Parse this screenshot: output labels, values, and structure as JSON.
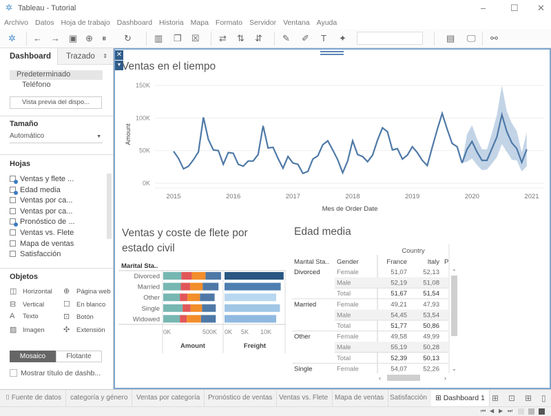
{
  "window": {
    "title": "Tableau - Tutorial",
    "minimize": "–",
    "maximize": "☐",
    "close": "✕"
  },
  "menu": [
    "Archivo",
    "Datos",
    "Hoja de trabajo",
    "Dashboard",
    "Historia",
    "Mapa",
    "Formato",
    "Servidor",
    "Ventana",
    "Ayuda"
  ],
  "toolbar": {
    "icons": [
      "tableau-logo",
      "back",
      "forward",
      "save",
      "new-datasource",
      "pause-updates",
      "refresh",
      "new-worksheet",
      "duplicate",
      "clear",
      "swap",
      "sort-asc",
      "sort-desc",
      "highlight",
      "annotate",
      "label",
      "pin",
      "show-me",
      "presentation",
      "share"
    ]
  },
  "left_panel": {
    "tabs": [
      "Dashboard",
      "Trazado"
    ],
    "devices": [
      "Predeterminado",
      "Teléfono"
    ],
    "preview_button": "Vista previa del dispo...",
    "size_title": "Tamaño",
    "size_value": "Automático",
    "sheets_title": "Hojas",
    "sheets": [
      {
        "label": "Ventas y flete ...",
        "used": true
      },
      {
        "label": "Edad media",
        "used": true
      },
      {
        "label": "Ventas por ca...",
        "used": false
      },
      {
        "label": "Ventas por ca...",
        "used": false
      },
      {
        "label": "Pronóstico de ...",
        "used": true
      },
      {
        "label": "Ventas vs. Flete",
        "used": false
      },
      {
        "label": "Mapa de ventas",
        "used": false
      },
      {
        "label": "Satisfacción",
        "used": false
      }
    ],
    "objects_title": "Objetos",
    "objects": [
      {
        "label": "Horizontal",
        "icon": "◫"
      },
      {
        "label": "Página web",
        "icon": "⊕"
      },
      {
        "label": "Vertical",
        "icon": "⊟"
      },
      {
        "label": "En blanco",
        "icon": "☐"
      },
      {
        "label": "Texto",
        "icon": "A"
      },
      {
        "label": "Botón",
        "icon": "⊡"
      },
      {
        "label": "Imagen",
        "icon": "▨"
      },
      {
        "label": "Extensión",
        "icon": "✣"
      }
    ],
    "layout_toggle": [
      "Mosaico",
      "Flotante"
    ],
    "show_title": "Mostrar título de dashb...",
    "show_title_checked": false
  },
  "chart_data": [
    {
      "type": "line",
      "title": "Ventas en el tiempo",
      "xlabel": "Mes de Order Date",
      "ylabel": "Amount",
      "x_ticks": [
        "2015",
        "2016",
        "2017",
        "2018",
        "2019",
        "2020",
        "2021"
      ],
      "y_ticks": [
        "0K",
        "50K",
        "100K",
        "150K"
      ],
      "ylim": [
        0,
        150000
      ],
      "grid": true,
      "start": "2015-01",
      "actual": [
        49000,
        38000,
        22000,
        26000,
        36000,
        48000,
        101000,
        67000,
        51000,
        50000,
        29000,
        47000,
        46000,
        29000,
        26000,
        34000,
        34000,
        44000,
        88000,
        54000,
        55000,
        38000,
        23000,
        41000,
        31000,
        29000,
        15000,
        18000,
        37000,
        42000,
        59000,
        65000,
        51000,
        36000,
        16000,
        34000,
        65000,
        44000,
        41000,
        33000,
        43000,
        66000,
        85000,
        79000,
        51000,
        53000,
        37000,
        43000,
        56000,
        47000,
        35000,
        27000,
        55000,
        82000,
        107000,
        83000,
        61000,
        56000,
        31000
      ],
      "forecast_start": "2019-11",
      "forecast": [
        31000,
        52000,
        64000,
        48000,
        35000,
        35000,
        53000,
        71000,
        105000,
        79000,
        62000,
        53000,
        32000,
        52000
      ],
      "forecast_low": [
        31000,
        33000,
        38000,
        28000,
        20000,
        21000,
        30000,
        40000,
        60000,
        48000,
        36000,
        35000,
        18000,
        26000
      ],
      "forecast_high": [
        31000,
        75000,
        89000,
        68000,
        52000,
        52000,
        77000,
        105000,
        150000,
        110000,
        92000,
        80000,
        47000,
        78000
      ],
      "colors": {
        "line": "#4e79a7",
        "band": "#b8cce3"
      }
    },
    {
      "type": "bar",
      "title": "Ventas y coste de flete por estado civil",
      "row_header": "Marital Sta..",
      "categories": [
        "Divorced",
        "Married",
        "Other",
        "Single",
        "Widowed"
      ],
      "panes": [
        {
          "name": "Amount",
          "x_ticks": [
            "0K",
            "500K"
          ],
          "xlim": [
            0,
            700000
          ],
          "stacked": true,
          "segment_colors": [
            "#76b7b2",
            "#e15759",
            "#f28e2b",
            "#4e79a7"
          ],
          "values": [
            [
              200000,
              114000,
              151000,
              171000
            ],
            [
              193000,
              103000,
              138000,
              174000
            ],
            [
              183000,
              83000,
              138000,
              161000
            ],
            [
              213000,
              88000,
              126000,
              151000
            ],
            [
              183000,
              76000,
              156000,
              163000
            ]
          ]
        },
        {
          "name": "Freight",
          "x_ticks": [
            "0K",
            "5K",
            "10K"
          ],
          "xlim": [
            0,
            14500
          ],
          "values": [
            14300,
            13600,
            12500,
            13400,
            12500
          ],
          "colors": [
            "#2a5783",
            "#4e7fb0",
            "#b9d7f0",
            "#a0c6e6",
            "#8fb9e0"
          ]
        }
      ]
    },
    {
      "type": "table",
      "title": "Edad media",
      "column_group": "Country",
      "headers": [
        "Marital Sta..",
        "Gender",
        "France",
        "Italy",
        "P"
      ],
      "rows": [
        [
          "Divorced",
          "Female",
          "51,07",
          "52,13"
        ],
        [
          "",
          "Male",
          "52,19",
          "51,08"
        ],
        [
          "",
          "Total",
          "51,67",
          "51,54"
        ],
        [
          "Married",
          "Female",
          "49,21",
          "47,93"
        ],
        [
          "",
          "Male",
          "54,45",
          "53,54"
        ],
        [
          "",
          "Total",
          "51,77",
          "50,86"
        ],
        [
          "Other",
          "Female",
          "49,58",
          "49,99"
        ],
        [
          "",
          "Male",
          "55,19",
          "50,28"
        ],
        [
          "",
          "Total",
          "52,39",
          "50,13"
        ],
        [
          "Single",
          "Female",
          "54,07",
          "52,26"
        ]
      ]
    }
  ],
  "tabs": {
    "datasource": "Fuente de datos",
    "sheets": [
      "categoría y género",
      "Ventas por categoría",
      "Pronóstico de ventas",
      "Ventas vs. Flete",
      "Mapa de ventas",
      "Satisfacción",
      "Dashboard 1"
    ],
    "active": "Dashboard 1"
  },
  "status": {
    "nav": [
      "⏮",
      "◀",
      "▶",
      "⏭"
    ]
  }
}
